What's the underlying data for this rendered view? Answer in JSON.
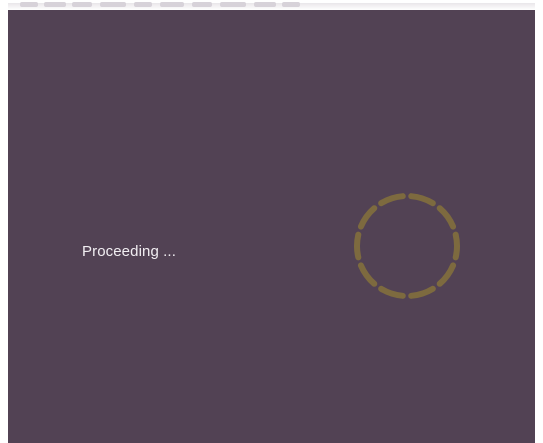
{
  "screen": {
    "background_color": "#524254",
    "status_text": "Proceeding ...",
    "spinner": {
      "icon": "loading-spinner-icon",
      "color": "#7d6a3f",
      "segments": 10
    }
  }
}
